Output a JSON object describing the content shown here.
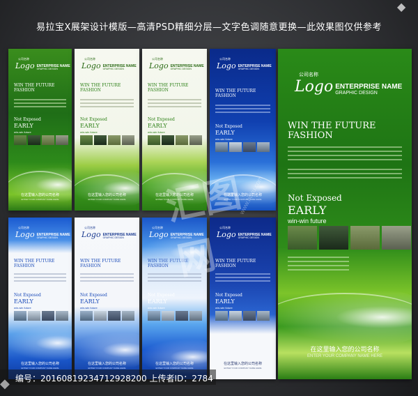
{
  "headline": "易拉宝X展架设计模版—高清PSD精细分层—文字色调随意更换—此效果图仅供参考",
  "banner_text": {
    "logo_small": "公司名称",
    "logo": "Logo",
    "enterprise": "ENTERPRISE NAME",
    "graphic": "GRAPHIC DESIGN",
    "win_line1": "WIN THE FUTURE",
    "win_line2": "FASHION",
    "not_exposed": "Not Exposed",
    "early": "EARLY",
    "winwin": "win-win future",
    "company_cn": "在这里输入您的公司名称",
    "company_en": "ENTER YOUR COMPANY NAME HERE"
  },
  "small_company_cn": "在这里输入您的公司名称",
  "small_company_en": "ENTER YOUR COMPANY NAME HERE",
  "watermark": {
    "id_line": "编号：20160819234712928200 上传者ID：2784",
    "logo": "汇图网",
    "site": "www.huitu.com"
  },
  "colors": {
    "green_dark": "#1f6e17",
    "green_light": "#7cc42a",
    "blue_dark": "#0d2a8a",
    "blue_light": "#3d8ee6",
    "white_banner": "#f4f7ee"
  },
  "banners": [
    {
      "id": "b1",
      "theme": "green"
    },
    {
      "id": "b2",
      "theme": "green-white"
    },
    {
      "id": "b3",
      "theme": "green-white"
    },
    {
      "id": "b4",
      "theme": "blue"
    },
    {
      "id": "b5",
      "theme": "blue-white"
    },
    {
      "id": "b6",
      "theme": "blue-white"
    },
    {
      "id": "b7",
      "theme": "blue"
    },
    {
      "id": "b8",
      "theme": "navy-white"
    },
    {
      "id": "b9",
      "theme": "green-large"
    }
  ]
}
